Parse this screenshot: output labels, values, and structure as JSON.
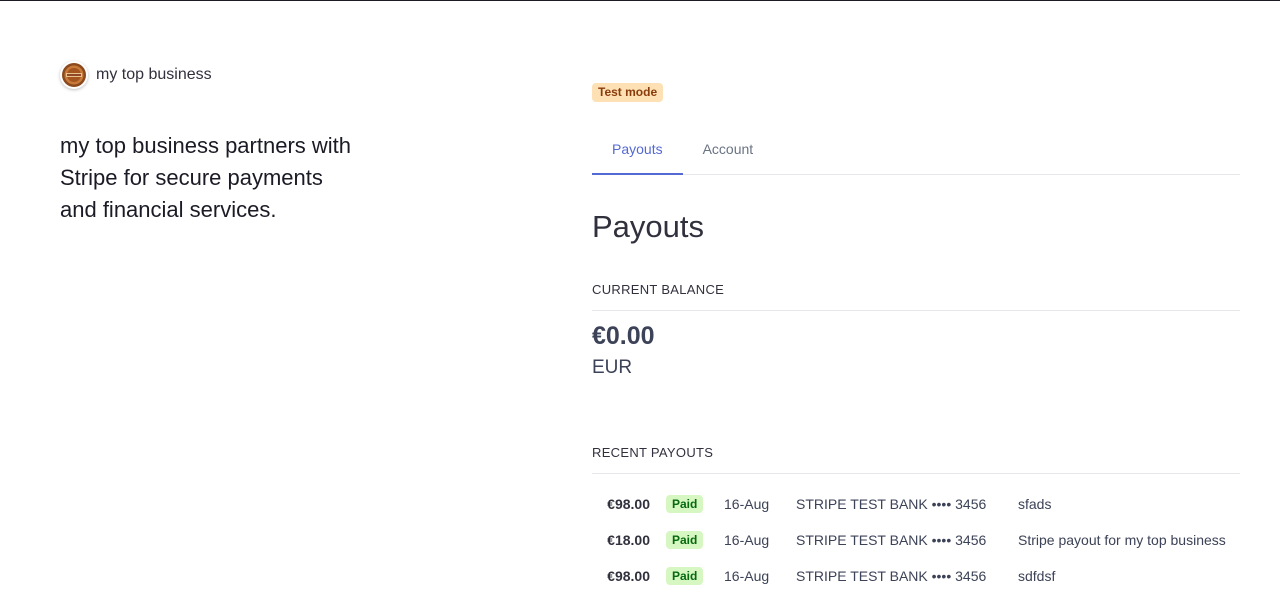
{
  "brand": {
    "name": "my top business",
    "tagline": "my top business partners with Stripe for secure payments and financial services."
  },
  "test_mode_label": "Test mode",
  "tabs": [
    {
      "label": "Payouts",
      "active": true
    },
    {
      "label": "Account",
      "active": false
    }
  ],
  "page_title": "Payouts",
  "balance": {
    "label": "CURRENT BALANCE",
    "amount": "€0.00",
    "currency": "EUR"
  },
  "recent_payouts": {
    "label": "RECENT PAYOUTS",
    "rows": [
      {
        "amount": "€98.00",
        "status": "Paid",
        "date": "16-Aug",
        "bank": "STRIPE TEST BANK •••• 3456",
        "description": "sfads"
      },
      {
        "amount": "€18.00",
        "status": "Paid",
        "date": "16-Aug",
        "bank": "STRIPE TEST BANK •••• 3456",
        "description": "Stripe payout for my top business"
      },
      {
        "amount": "€98.00",
        "status": "Paid",
        "date": "16-Aug",
        "bank": "STRIPE TEST BANK •••• 3456",
        "description": "sdfdsf"
      }
    ]
  },
  "colors": {
    "accent": "#5469d4",
    "paid_bg": "#d7f7c2",
    "paid_text": "#05690d",
    "test_bg": "#fde0b3",
    "test_text": "#8a3c0c"
  },
  "icons": {
    "brand_logo": "brand-logo-icon"
  }
}
